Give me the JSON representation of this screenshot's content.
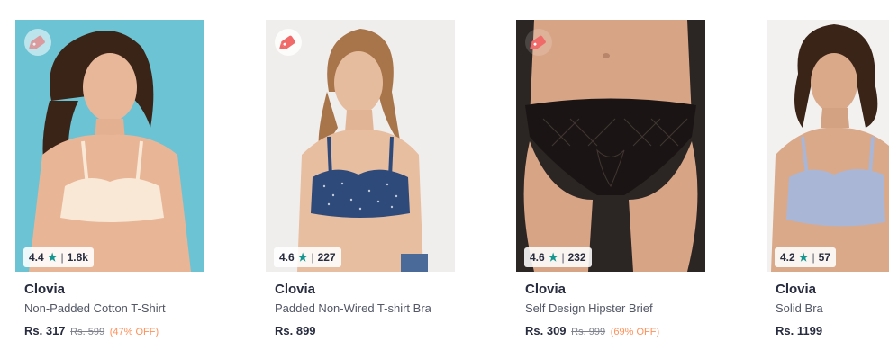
{
  "products": [
    {
      "brand": "Clovia",
      "name": "Non-Padded Cotton T-Shirt",
      "price": "Rs. 317",
      "mrp": "Rs. 599",
      "discount": "(47% OFF)",
      "rating": "4.4",
      "rating_count": "1.8k",
      "image_bg": "#6cc3d4",
      "image_desc": "model-cream-tshirt-bra"
    },
    {
      "brand": "Clovia",
      "name": "Padded Non-Wired T-shirt Bra",
      "price": "Rs. 899",
      "mrp": "",
      "discount": "",
      "rating": "4.6",
      "rating_count": "227",
      "image_bg": "#f0eeec",
      "image_desc": "model-navy-polka-dot-bra"
    },
    {
      "brand": "Clovia",
      "name": "Self Design Hipster Brief",
      "price": "Rs. 309",
      "mrp": "Rs. 999",
      "discount": "(69% OFF)",
      "rating": "4.6",
      "rating_count": "232",
      "image_bg": "#2b2523",
      "image_desc": "black-lace-hipster-brief"
    },
    {
      "brand": "Clovia",
      "name": "Solid Bra",
      "price": "Rs. 1199",
      "mrp": "",
      "discount": "",
      "rating": "4.2",
      "rating_count": "57",
      "image_bg": "#f3f1ef",
      "image_desc": "model-lavender-satin-bra"
    }
  ],
  "icons": {
    "wishlist": "price-tag-icon",
    "rating_star": "star-icon"
  },
  "colors": {
    "tag": "#f06a6a",
    "star": "#14958f",
    "discount": "#ff905a"
  }
}
